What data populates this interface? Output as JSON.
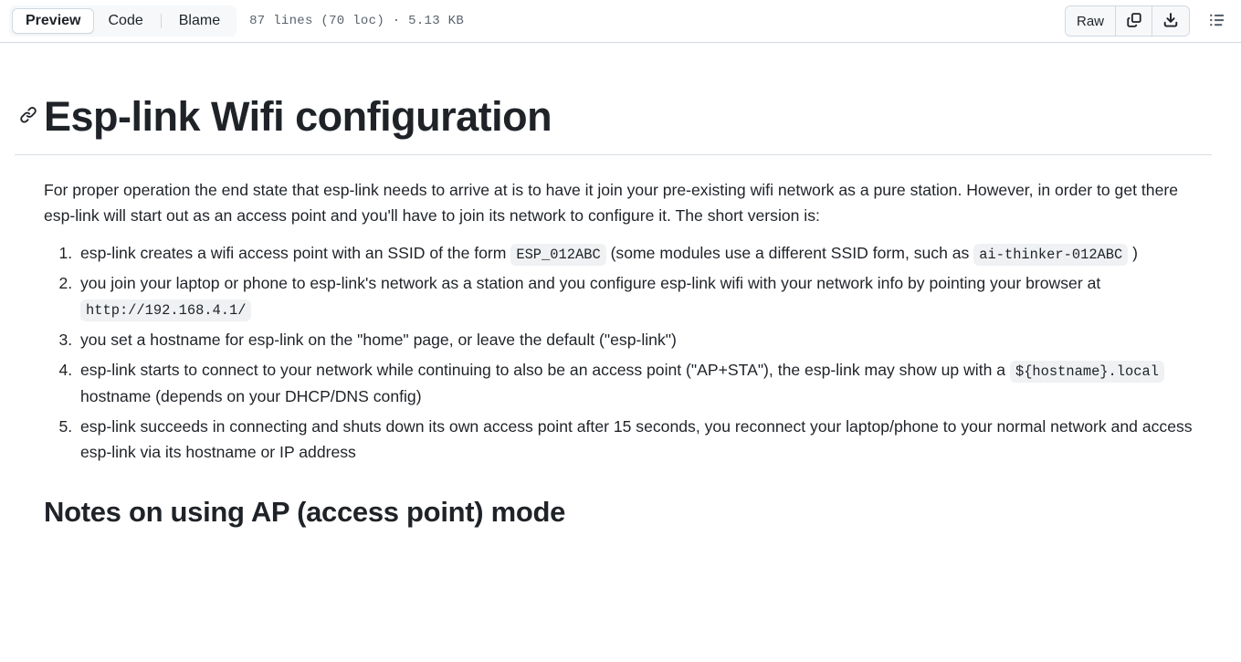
{
  "header": {
    "tabs": [
      {
        "label": "Preview",
        "selected": true
      },
      {
        "label": "Code",
        "selected": false
      },
      {
        "label": "Blame",
        "selected": false
      }
    ],
    "file_meta": "87 lines (70 loc) · 5.13 KB",
    "raw_label": "Raw",
    "copy_icon": "copy-icon",
    "download_icon": "download-icon",
    "outline_icon": "outline-list-icon"
  },
  "document": {
    "title": "Esp-link Wifi configuration",
    "anchor_icon": "link-anchor-icon",
    "intro_paragraph": "For proper operation the end state that esp-link needs to arrive at is to have it join your pre-existing wifi network as a pure station. However, in order to get there esp-link will start out as an access point and you'll have to join its network to configure it. The short version is:",
    "steps": [
      {
        "parts": [
          {
            "type": "text",
            "value": "esp-link creates a wifi access point with an SSID of the form "
          },
          {
            "type": "code",
            "value": "ESP_012ABC"
          },
          {
            "type": "text",
            "value": " (some modules use a different SSID form, such as "
          },
          {
            "type": "code",
            "value": "ai-thinker-012ABC"
          },
          {
            "type": "text",
            "value": " )"
          }
        ]
      },
      {
        "parts": [
          {
            "type": "text",
            "value": "you join your laptop or phone to esp-link's network as a station and you configure esp-link wifi with your network info by pointing your browser at "
          },
          {
            "type": "code",
            "value": "http://192.168.4.1/"
          }
        ]
      },
      {
        "parts": [
          {
            "type": "text",
            "value": "you set a hostname for esp-link on the \"home\" page, or leave the default (\"esp-link\")"
          }
        ]
      },
      {
        "parts": [
          {
            "type": "text",
            "value": "esp-link starts to connect to your network while continuing to also be an access point (\"AP+STA\"), the esp-link may show up with a "
          },
          {
            "type": "code",
            "value": "${hostname}.local"
          },
          {
            "type": "text",
            "value": " hostname (depends on your DHCP/DNS config)"
          }
        ]
      },
      {
        "parts": [
          {
            "type": "text",
            "value": "esp-link succeeds in connecting and shuts down its own access point after 15 seconds, you reconnect your laptop/phone to your normal network and access esp-link via its hostname or IP address"
          }
        ]
      }
    ],
    "section_heading": "Notes on using AP (access point) mode"
  },
  "colors": {
    "text": "#1f2328",
    "muted": "#59636e",
    "border": "#d1d9e0",
    "code_bg": "#eff1f3",
    "segmented_bg": "#f6f8fa",
    "page_bg": "#ffffff"
  }
}
